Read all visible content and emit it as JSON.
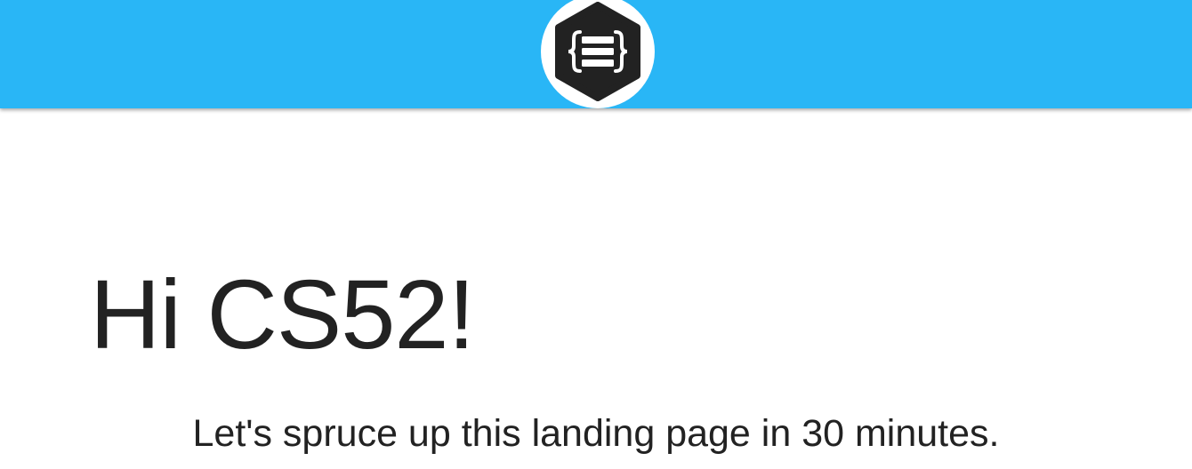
{
  "header": {
    "background_color": "#29b6f6",
    "logo": {
      "icon": "curly-braces-hexagon-icon",
      "background_color": "#222222",
      "ring_color": "#ffffff"
    }
  },
  "hero": {
    "title": "Hi CS52!",
    "subtitle": "Let's spruce up this landing page in 30 minutes.",
    "text_color": "#222222"
  }
}
